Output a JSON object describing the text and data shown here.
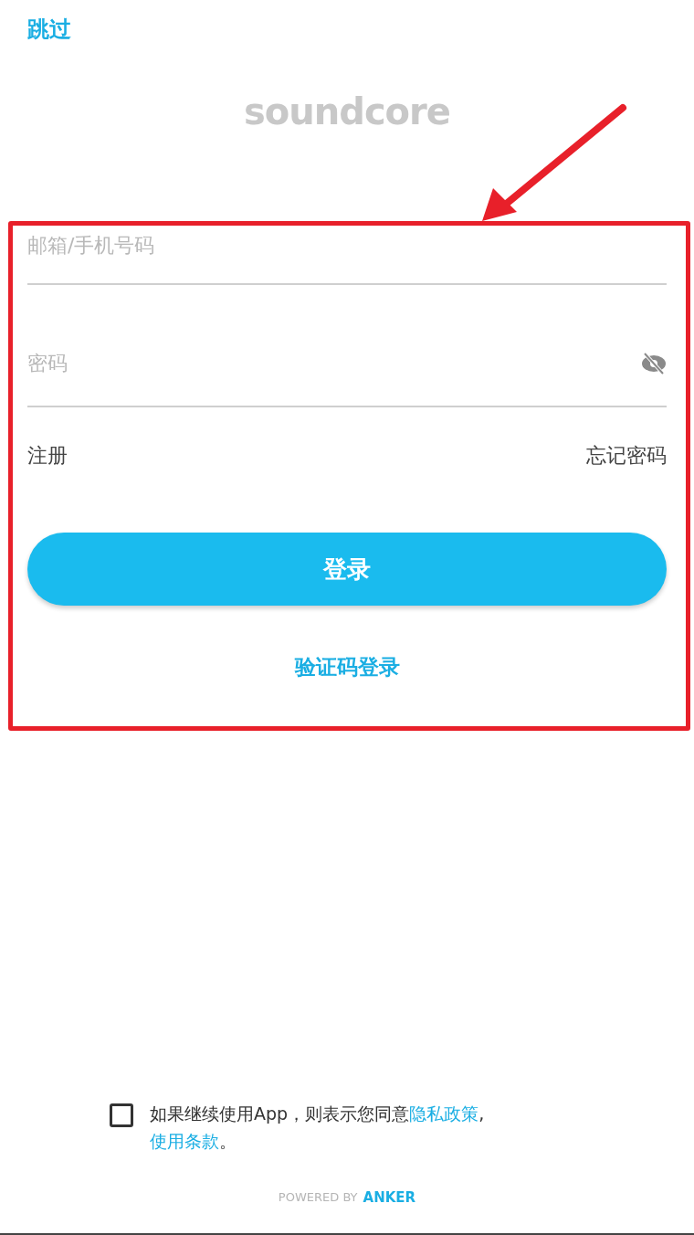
{
  "skip": "跳过",
  "logo": "soundcore",
  "form": {
    "account": {
      "placeholder": "邮箱/手机号码"
    },
    "password": {
      "placeholder": "密码",
      "visible": false
    },
    "register": "注册",
    "forgot": "忘记密码",
    "login": "登录",
    "code_login": "验证码登录"
  },
  "agreement": {
    "checked": false,
    "text": "如果继续使用App，则表示您同意",
    "privacy": "隐私政策",
    "sep": ",",
    "terms": "使用条款",
    "end": "。"
  },
  "footer": {
    "powered": "POWERED BY",
    "brand": "ANKER"
  }
}
